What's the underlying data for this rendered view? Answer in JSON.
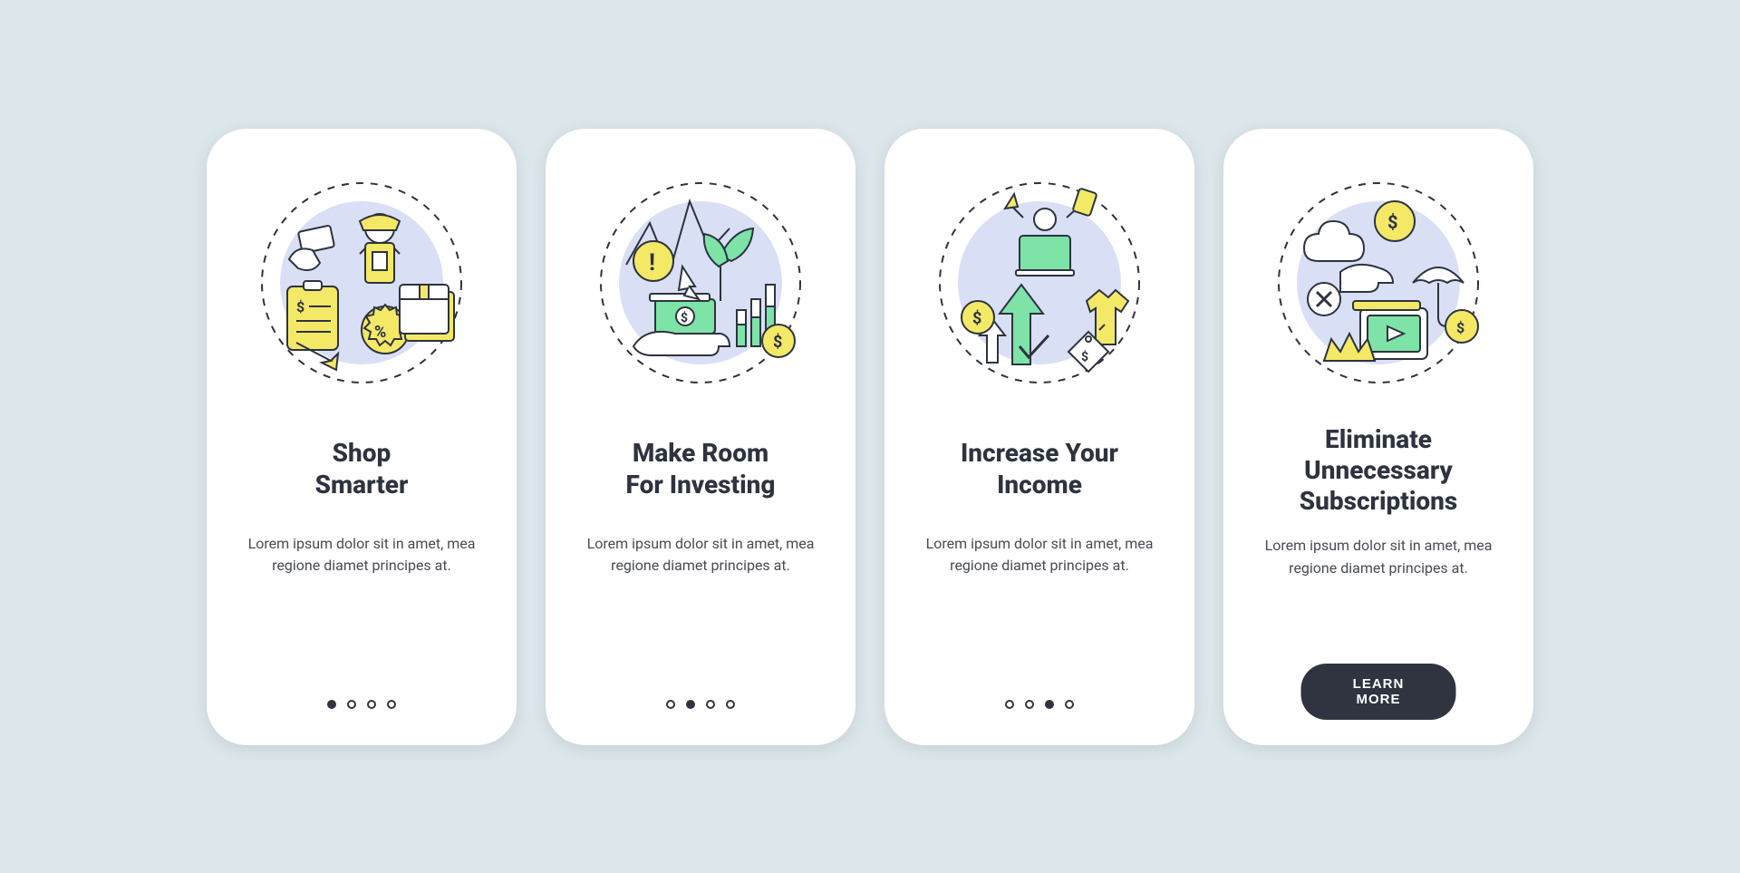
{
  "colors": {
    "dark": "#2d333f",
    "yellow": "#f4e867",
    "green": "#7de3a7",
    "lavender": "#d9dff5",
    "bg": "#dce7ec"
  },
  "cards": [
    {
      "title": "Shop\nSmarter",
      "desc": "Lorem ipsum dolor sit in amet, mea regione diamet principes at.",
      "active_dot": 0,
      "show_dots": true,
      "show_cta": false
    },
    {
      "title": "Make Room\nFor Investing",
      "desc": "Lorem ipsum dolor sit in amet, mea regione diamet principes at.",
      "active_dot": 1,
      "show_dots": true,
      "show_cta": false
    },
    {
      "title": "Increase Your\nIncome",
      "desc": "Lorem ipsum dolor sit in amet, mea regione diamet principes at.",
      "active_dot": 2,
      "show_dots": true,
      "show_cta": false
    },
    {
      "title": "Eliminate\nUnnecessary\nSubscriptions",
      "desc": "Lorem ipsum dolor sit in amet, mea regione diamet principes at.",
      "active_dot": 3,
      "show_dots": false,
      "show_cta": true
    }
  ],
  "cta_label": "LEARN MORE",
  "dot_count": 4
}
